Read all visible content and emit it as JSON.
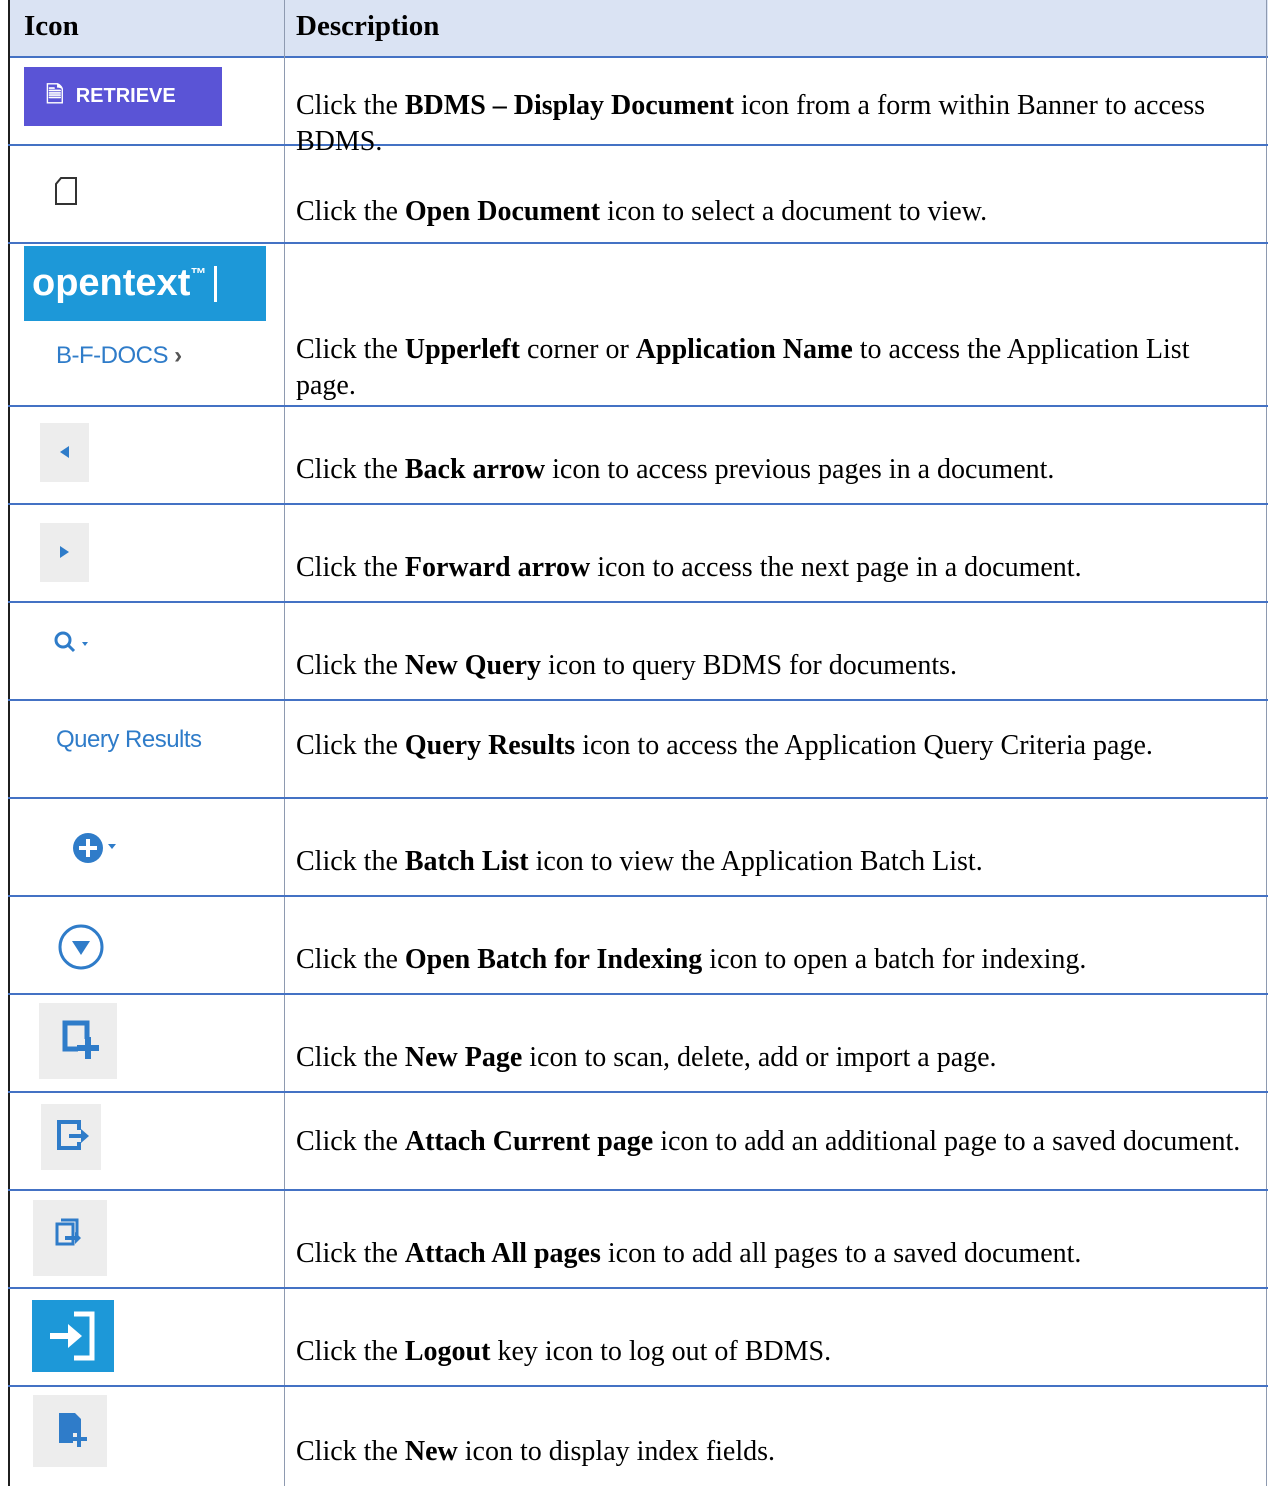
{
  "header": {
    "icon_col": "Icon",
    "desc_col": "Description"
  },
  "icons": {
    "retrieve_label": "RETRIEVE",
    "opentext_label": "opentext",
    "bfdocs_label": "B-F-DOCS",
    "query_results_label": "Query Results"
  },
  "rows": [
    {
      "pre": "Click the ",
      "bold": "BDMS – Display Document",
      "post": " icon from a form within Banner to access BDMS."
    },
    {
      "pre": "Click the ",
      "bold": "Open Document",
      "post": " icon to select a document to view."
    },
    {
      "pre": "Click the ",
      "bold": "Upperleft",
      "mid": " corner or ",
      "bold2": "Application Name",
      "post": " to access the Application List page."
    },
    {
      "pre": "Click the ",
      "bold": "Back arrow",
      "post": " icon to access previous pages in a document."
    },
    {
      "pre": "Click the ",
      "bold": "Forward arrow",
      "post": " icon to access the next page in a document."
    },
    {
      "pre": "Click the ",
      "bold": "New Query",
      "post": " icon to query BDMS for documents."
    },
    {
      "pre": "Click the ",
      "bold": "Query Results",
      "post": " icon to access the Application Query Criteria page."
    },
    {
      "pre": "Click the ",
      "bold": "Batch List",
      "post": " icon to view the Application Batch List."
    },
    {
      "pre": "Click the ",
      "bold": "Open Batch for Indexing",
      "post": " icon to open a batch for indexing."
    },
    {
      "pre": "Click the ",
      "bold": "New Page",
      "post": " icon to scan, delete, add or import a page."
    },
    {
      "pre": "Click the ",
      "bold": "Attach Current page",
      "post": " icon to add an additional page to a saved document."
    },
    {
      "pre": "Click the ",
      "bold": "Attach All pages",
      "post": " icon to add all pages to a saved document."
    },
    {
      "pre": "Click the ",
      "bold": "Logout",
      "post": " key icon to log out of BDMS."
    },
    {
      "pre": "Click the ",
      "bold": "New",
      "post": " icon to display index fields."
    }
  ]
}
